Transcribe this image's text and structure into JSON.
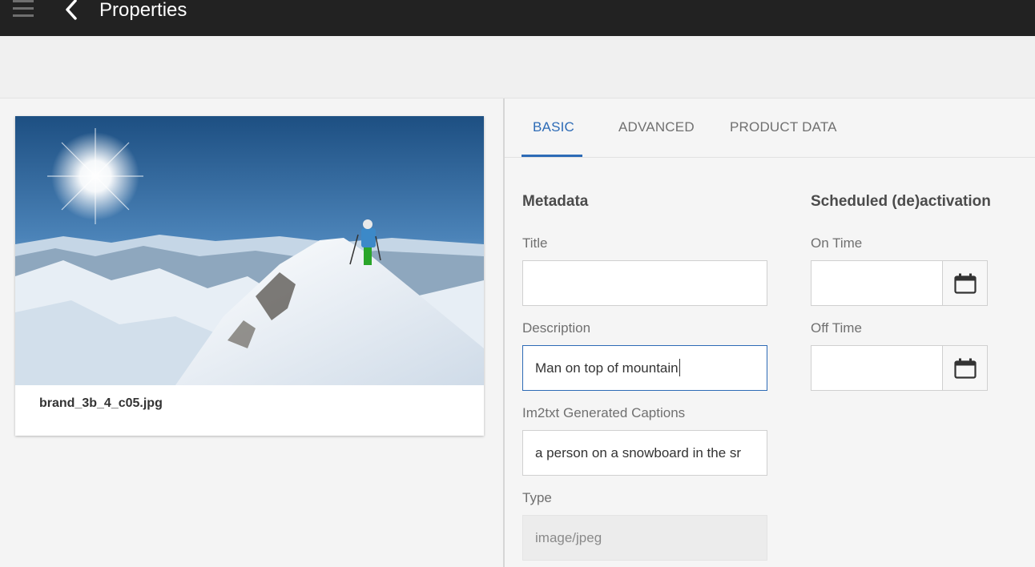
{
  "header": {
    "title": "Properties",
    "menu_icon": "hamburger-menu-icon",
    "back_icon": "chevron-left-icon"
  },
  "asset": {
    "filename": "brand_3b_4_c05.jpg",
    "image_description": "snow-mountain-skier-photo"
  },
  "tabs": [
    {
      "label": "BASIC",
      "active": true
    },
    {
      "label": "ADVANCED",
      "active": false
    },
    {
      "label": "PRODUCT DATA",
      "active": false
    }
  ],
  "metadata": {
    "heading": "Metadata",
    "title": {
      "label": "Title",
      "value": ""
    },
    "description": {
      "label": "Description",
      "value": "Man on top of mountain"
    },
    "captions": {
      "label": "Im2txt Generated Captions",
      "value": "a person on a snowboard in the sr"
    },
    "type": {
      "label": "Type",
      "value": "image/jpeg"
    }
  },
  "scheduling": {
    "heading": "Scheduled (de)activation",
    "on_time": {
      "label": "On Time",
      "value": ""
    },
    "off_time": {
      "label": "Off Time",
      "value": ""
    },
    "calendar_icon": "calendar-icon"
  },
  "colors": {
    "topbar": "#222222",
    "accent": "#2d6bb6",
    "background": "#f4f4f4"
  }
}
